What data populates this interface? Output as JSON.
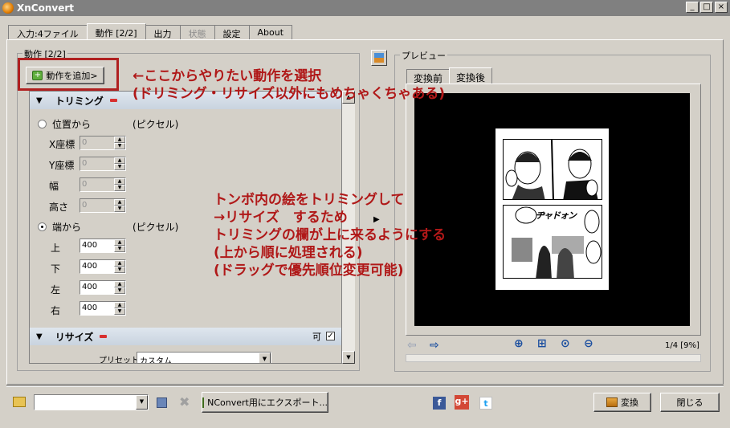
{
  "window": {
    "title": "XnConvert",
    "buttons": [
      "_",
      "□",
      "×"
    ]
  },
  "tabs": [
    {
      "label": "入力:4ファイル",
      "state": "normal"
    },
    {
      "label": "動作 [2/2]",
      "state": "active"
    },
    {
      "label": "出力",
      "state": "normal"
    },
    {
      "label": "状態",
      "state": "disabled"
    },
    {
      "label": "設定",
      "state": "normal"
    },
    {
      "label": "About",
      "state": "normal"
    }
  ],
  "actions_group": {
    "legend": "動作 [2/2]",
    "add_button_label": "動作を追加>"
  },
  "trimming": {
    "header": "トリミング",
    "from_position_label": "位置から",
    "from_position_unit": "(ピクセル)",
    "x_label": "X座標",
    "y_label": "Y座標",
    "width_label": "幅",
    "height_label": "高さ",
    "x_value": "0",
    "y_value": "0",
    "width_value": "0",
    "height_value": "0",
    "from_edge_label": "端から",
    "from_edge_unit": "(ピクセル)",
    "top_label": "上",
    "bottom_label": "下",
    "left_label": "左",
    "right_label": "右",
    "top_value": "400",
    "bottom_value": "400",
    "left_value": "400",
    "right_value": "400"
  },
  "resize": {
    "header": "リサイズ",
    "enable_label": "可",
    "preset_label": "プリセット",
    "preset_value": "カスタム"
  },
  "preview": {
    "legend": "プレビュー",
    "tabs": [
      "変換前",
      "変換後"
    ],
    "page_indicator": "1/4 [9%]"
  },
  "annotations": {
    "top_line1": "←ここからやりたい動作を選択",
    "top_line2": "(ドリミング・リサイズ以外にもめちゃくちゃある)",
    "mid_line1": "トンボ内の絵をトリミングして",
    "mid_line2": "→リサイズ　するため",
    "mid_line3": "トリミングの欄が上に来るようにする",
    "mid_line4": "(上から順に処理される)",
    "mid_line5": "(ドラッグで優先順位変更可能)"
  },
  "manga_text": {
    "sfx": "ヂャドォン"
  },
  "bottom": {
    "path_value": "",
    "export_button": "NConvert用にエクスポート...",
    "convert_button": "変換",
    "close_button": "閉じる"
  },
  "colors": {
    "window_bg": "#d4d0c8",
    "annotation_red": "#b01818",
    "section_header": "#c9d3df"
  }
}
